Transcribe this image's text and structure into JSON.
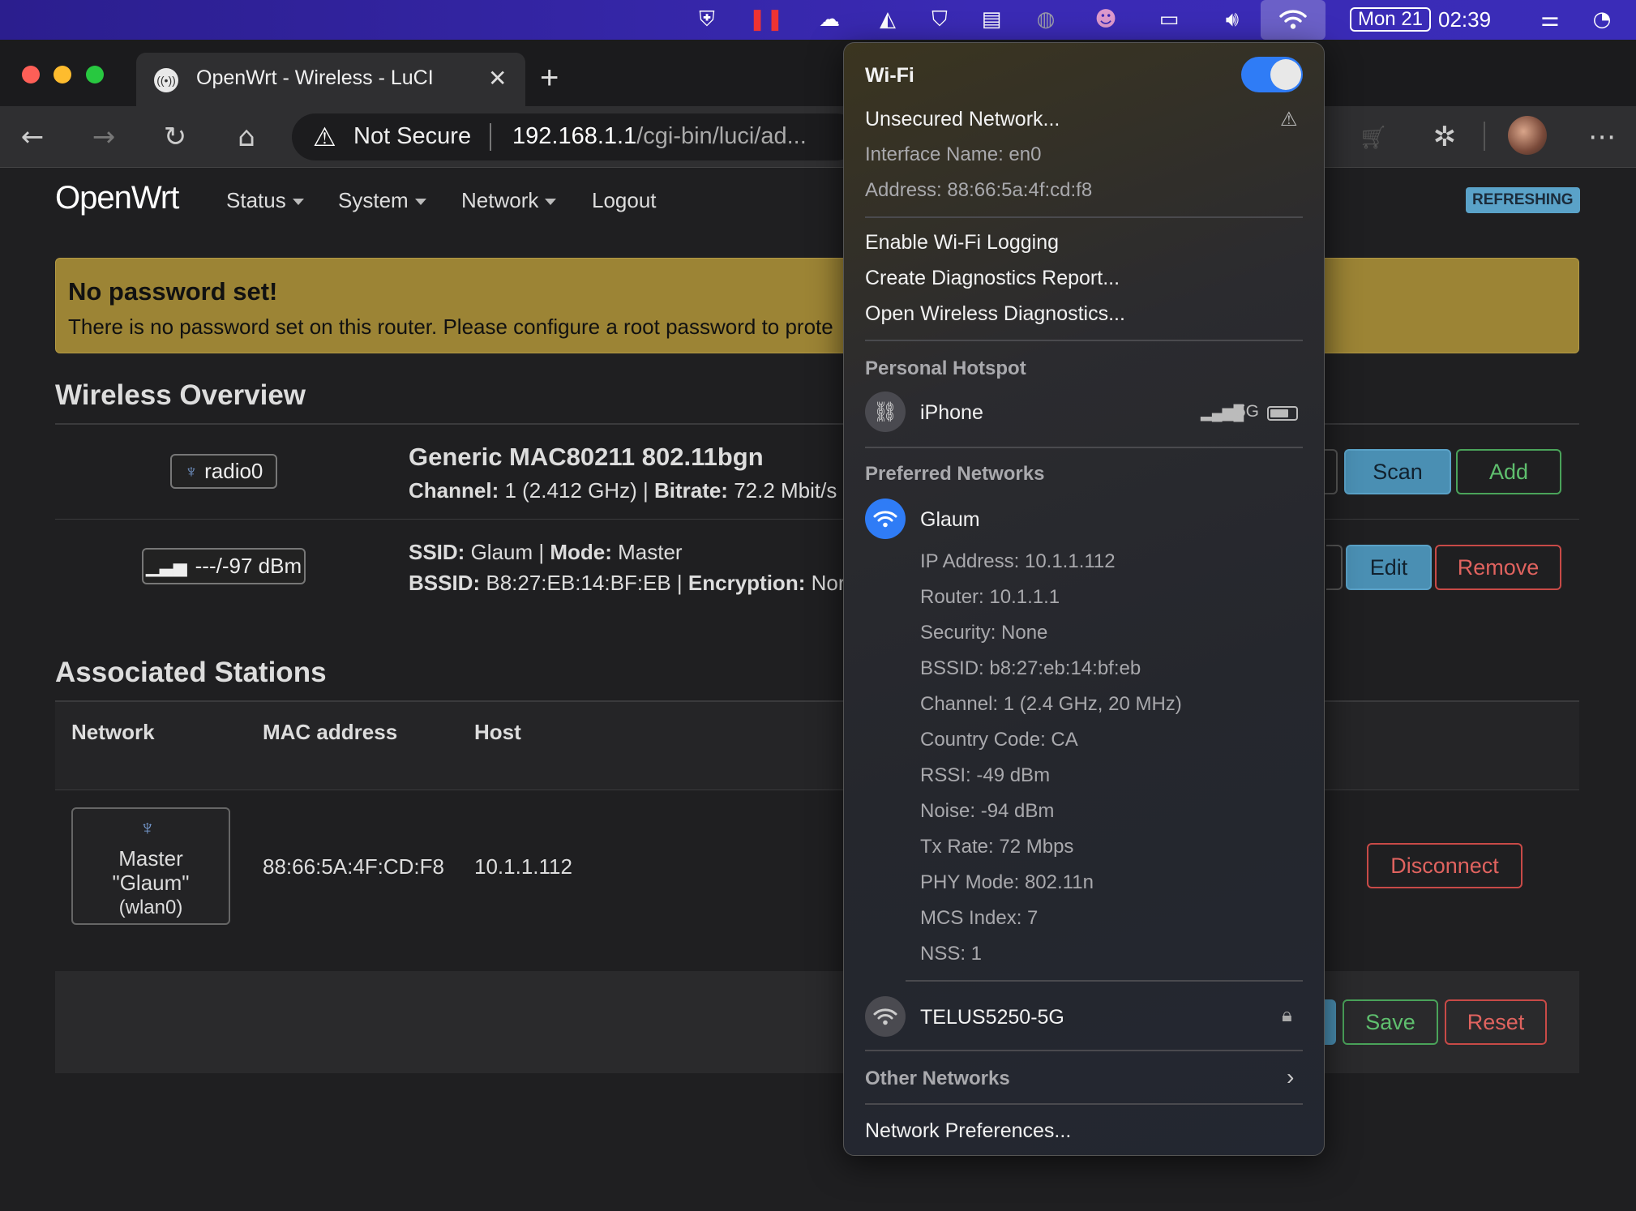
{
  "menubar": {
    "date": "Mon 21",
    "time": "02:39",
    "icons": [
      "shield-x-icon",
      "pause-icon",
      "cloud-x-icon",
      "drive-icon",
      "shield-half-icon",
      "clipboard-icon",
      "globe-icon",
      "avatar-icon",
      "battery-charging-icon",
      "volume-icon",
      "wifi-icon",
      "control-center-icon",
      "siri-icon"
    ]
  },
  "browser": {
    "tab_title": "OpenWrt - Wireless - LuCI",
    "security_label": "Not Secure",
    "url_host": "192.168.1.1",
    "url_path": "/cgi-bin/luci/ad..."
  },
  "page": {
    "logo": "OpenWrt",
    "nav": [
      {
        "label": "Status",
        "dropdown": true
      },
      {
        "label": "System",
        "dropdown": true
      },
      {
        "label": "Network",
        "dropdown": true
      },
      {
        "label": "Logout",
        "dropdown": false
      }
    ],
    "refreshing_badge": "REFRESHING",
    "alert": {
      "title": "No password set!",
      "text": "There is no password set on this router. Please configure a root password to prote"
    },
    "wireless_overview": {
      "heading": "Wireless Overview",
      "radio_badge": "radio0",
      "radio_name": "Generic MAC80211 802.11bgn",
      "channel_label": "Channel:",
      "channel_value": " 1 (2.412 GHz) | ",
      "bitrate_label": "Bitrate:",
      "bitrate_value": " 72.2 Mbit/s",
      "signal_badge": "---/-97 dBm",
      "ssid_label": "SSID:",
      "ssid_value": " Glaum | ",
      "mode_label": "Mode:",
      "mode_value": " Master",
      "bssid_label": "BSSID:",
      "bssid_value": " B8:27:EB:14:BF:EB | ",
      "encryption_label": "Encryption:",
      "encryption_value": " Nor",
      "scan_button": "Scan",
      "add_button": "Add",
      "edit_button": "Edit",
      "remove_button": "Remove"
    },
    "associated_stations": {
      "heading": "Associated Stations",
      "columns": [
        "Network",
        "MAC address",
        "Host"
      ],
      "rows": [
        {
          "network_line1": "Master",
          "network_line2": "\"Glaum\"",
          "network_line3": "(wlan0)",
          "mac": "88:66:5A:4F:CD:F8",
          "host": "10.1.1.112",
          "action": "Disconnect"
        }
      ]
    },
    "footer": {
      "save": "Save",
      "reset": "Reset"
    }
  },
  "wifi_menu": {
    "title": "Wi-Fi",
    "toggle_on": true,
    "unsecured": "Unsecured Network...",
    "interface_name": "Interface Name: en0",
    "address": "Address: 88:66:5a:4f:cd:f8",
    "enable_logging": "Enable Wi-Fi Logging",
    "diagnostics_report": "Create Diagnostics Report...",
    "wireless_diagnostics": "Open Wireless Diagnostics...",
    "hotspot_section": "Personal Hotspot",
    "hotspot_name": "iPhone",
    "hotspot_network": "5G",
    "preferred_section": "Preferred Networks",
    "connected_network": "Glaum",
    "details": [
      "IP Address: 10.1.1.112",
      "Router: 10.1.1.1",
      "Security: None",
      "BSSID: b8:27:eb:14:bf:eb",
      "Channel: 1 (2.4 GHz, 20 MHz)",
      "Country Code: CA",
      "RSSI: -49 dBm",
      "Noise: -94 dBm",
      "Tx Rate: 72 Mbps",
      "PHY Mode: 802.11n",
      "MCS Index: 7",
      "NSS: 1"
    ],
    "other_preferred": "TELUS5250-5G",
    "other_networks": "Other Networks",
    "preferences": "Network Preferences...",
    "accent_color": "#2f7cf6"
  }
}
